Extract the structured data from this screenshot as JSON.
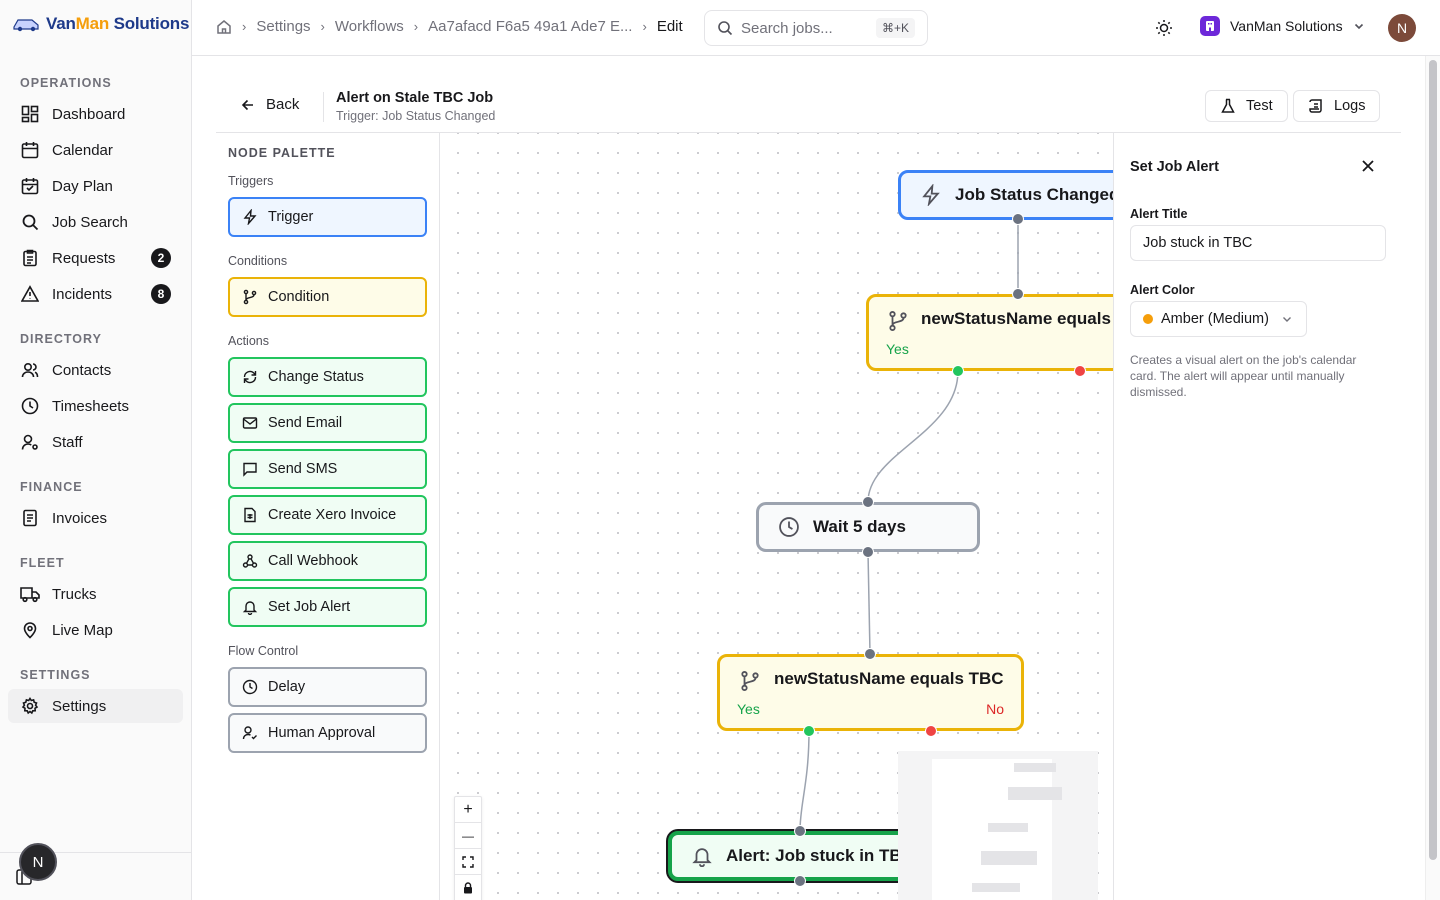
{
  "brand": {
    "part1": "Van",
    "part2": "Man",
    "part3": " Solutions"
  },
  "sidebar": {
    "sections": {
      "operations": "OPERATIONS",
      "directory": "DIRECTORY",
      "finance": "FINANCE",
      "fleet": "FLEET",
      "settings": "SETTINGS"
    },
    "items": [
      {
        "label": "Dashboard",
        "icon": "dashboard-icon"
      },
      {
        "label": "Calendar",
        "icon": "calendar-icon"
      },
      {
        "label": "Day Plan",
        "icon": "dayplan-icon"
      },
      {
        "label": "Job Search",
        "icon": "search-icon"
      },
      {
        "label": "Requests",
        "icon": "clipboard-icon",
        "badge": "2"
      },
      {
        "label": "Incidents",
        "icon": "warning-icon",
        "badge": "8"
      },
      {
        "label": "Contacts",
        "icon": "users-icon"
      },
      {
        "label": "Timesheets",
        "icon": "clock-icon"
      },
      {
        "label": "Staff",
        "icon": "staff-icon"
      },
      {
        "label": "Invoices",
        "icon": "invoice-icon"
      },
      {
        "label": "Trucks",
        "icon": "truck-icon"
      },
      {
        "label": "Live Map",
        "icon": "map-pin-icon"
      },
      {
        "label": "Settings",
        "icon": "gear-icon",
        "active": true
      }
    ],
    "user_initial": "N"
  },
  "topbar": {
    "breadcrumbs": [
      "Settings",
      "Workflows",
      "Aa7afacd F6a5 49a1 Ade7 E...",
      "Edit"
    ],
    "search_placeholder": "Search jobs...",
    "search_shortcut": "⌘+K",
    "org_name": "VanMan Solutions",
    "avatar_initial": "N"
  },
  "workflow": {
    "back_label": "Back",
    "title": "Alert on Stale TBC Job",
    "subtitle": "Trigger: Job Status Changed",
    "test_label": "Test",
    "logs_label": "Logs"
  },
  "palette": {
    "title": "NODE PALETTE",
    "groups": {
      "triggers": "Triggers",
      "conditions": "Conditions",
      "actions": "Actions",
      "flow": "Flow Control"
    },
    "items": {
      "trigger": "Trigger",
      "condition": "Condition",
      "change_status": "Change Status",
      "send_email": "Send Email",
      "send_sms": "Send SMS",
      "xero": "Create Xero Invoice",
      "webhook": "Call Webhook",
      "job_alert": "Set Job Alert",
      "delay": "Delay",
      "approval": "Human Approval"
    }
  },
  "canvas": {
    "nodes": {
      "trigger": "Job Status Changed",
      "cond1": "newStatusName equals TBC",
      "wait": "Wait 5 days",
      "cond2": "newStatusName equals TBC",
      "alert": "Alert: Job stuck in TBC"
    },
    "yes_label": "Yes",
    "no_label": "No",
    "controls": {
      "zoom_in": "+",
      "zoom_out": "—"
    }
  },
  "panel": {
    "title": "Set Job Alert",
    "alert_title_label": "Alert Title",
    "alert_title_value": "Job stuck in TBC",
    "alert_color_label": "Alert Color",
    "alert_color_value": "Amber (Medium)",
    "alert_color_hex": "#f59e0b",
    "help_text": "Creates a visual alert on the job's calendar card. The alert will appear until manually dismissed."
  }
}
